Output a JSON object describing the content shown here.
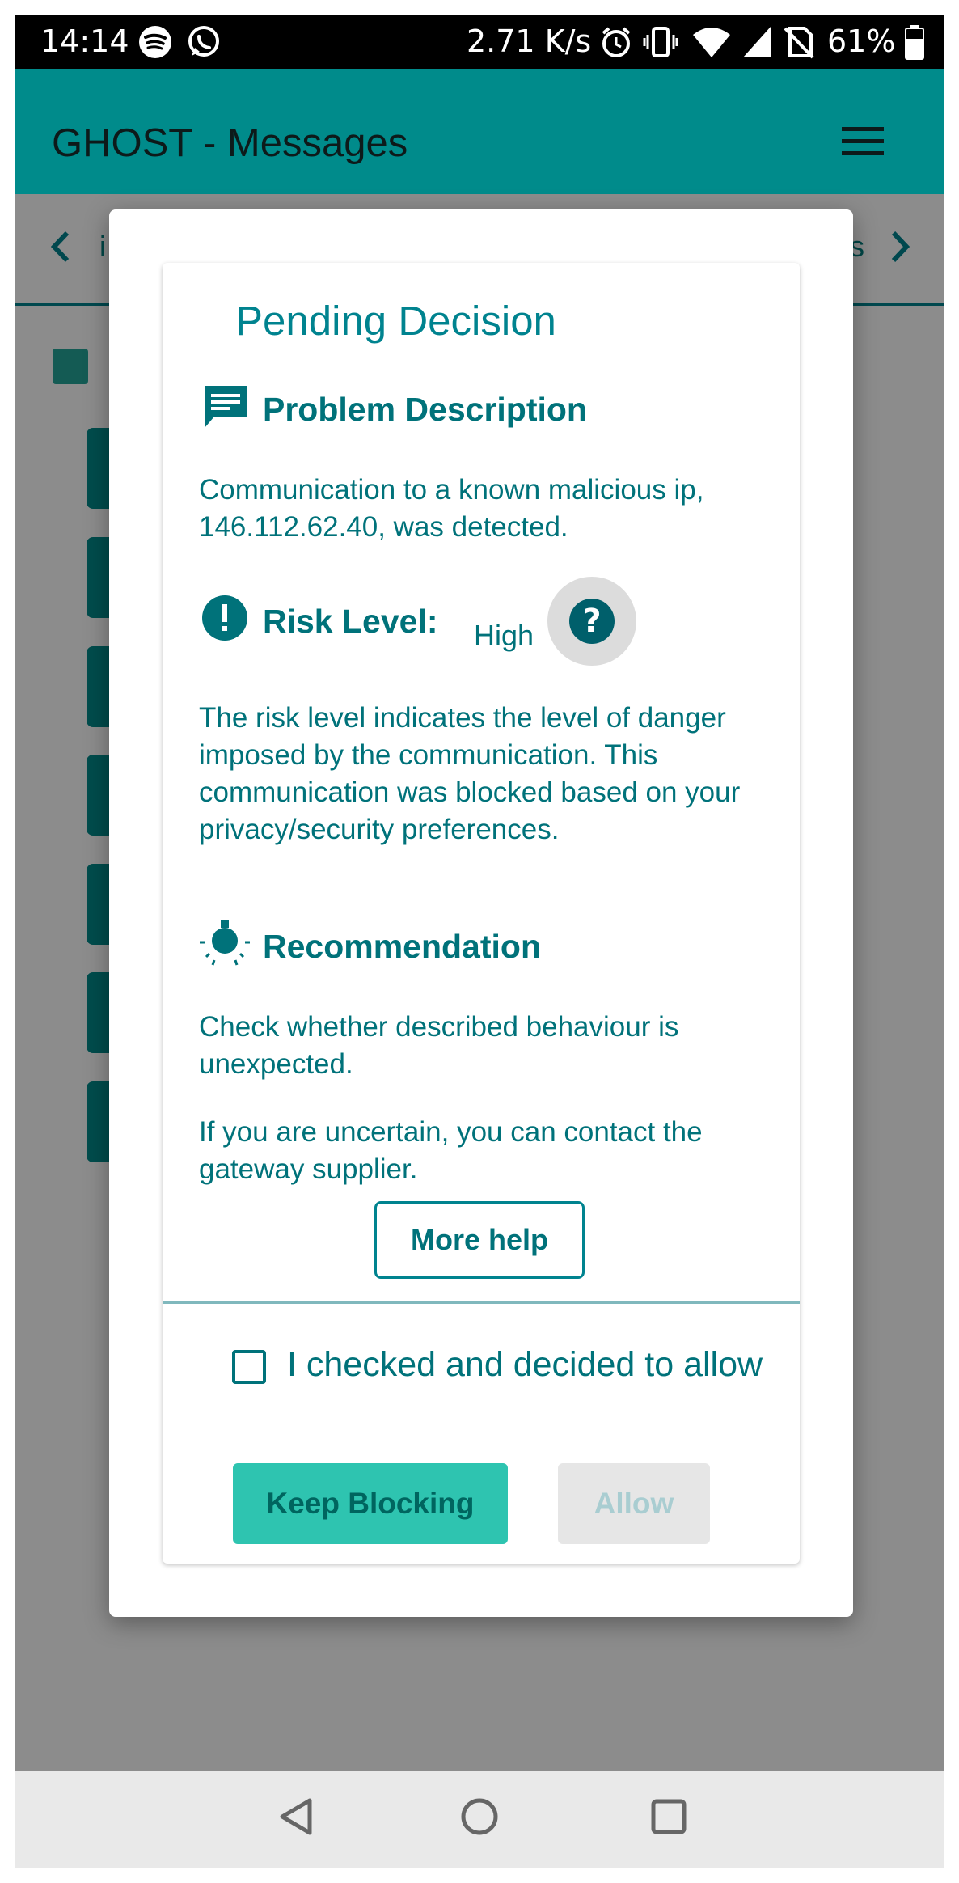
{
  "status_bar": {
    "time": "14:14",
    "network_rate": "2.71 K/s",
    "battery": "61%",
    "icons": [
      "spotify-icon",
      "whatsapp-icon",
      "alarm-icon",
      "vibrate-icon",
      "wifi-icon",
      "signal-icon",
      "no-sim-icon",
      "battery-icon"
    ]
  },
  "app_bar": {
    "title": "GHOST - Messages",
    "menu_icon": "hamburger-menu-icon"
  },
  "background_tabs": {
    "left_partial": "i",
    "right_partial": "s"
  },
  "dialog": {
    "heading": "Pending Decision",
    "problem": {
      "title": "Problem Description",
      "icon": "message-icon",
      "text": "Communication to a known malicious ip, 146.112.62.40, was detected."
    },
    "risk": {
      "title": "Risk Level:",
      "icon": "exclamation-icon",
      "value": "High",
      "help_icon": "question-icon",
      "explanation": "The risk level indicates the level of danger imposed by the communication. This communication was blocked based on your privacy/security preferences."
    },
    "recommendation": {
      "title": "Recommendation",
      "icon": "lightbulb-icon",
      "text1": "Check whether described behaviour is unexpected.",
      "text2": "If you are uncertain, you can contact the gateway supplier."
    },
    "more_help_label": "More help",
    "allow_checkbox_label": "I checked and decided to allow",
    "allow_checkbox_checked": false,
    "keep_blocking_label": "Keep Blocking",
    "allow_label": "Allow",
    "allow_enabled": false
  },
  "colors": {
    "primary": "#008B8B",
    "text_teal": "#00727a",
    "keep_button": "#2ec4b0",
    "disabled_button": "#e6e6e6"
  }
}
